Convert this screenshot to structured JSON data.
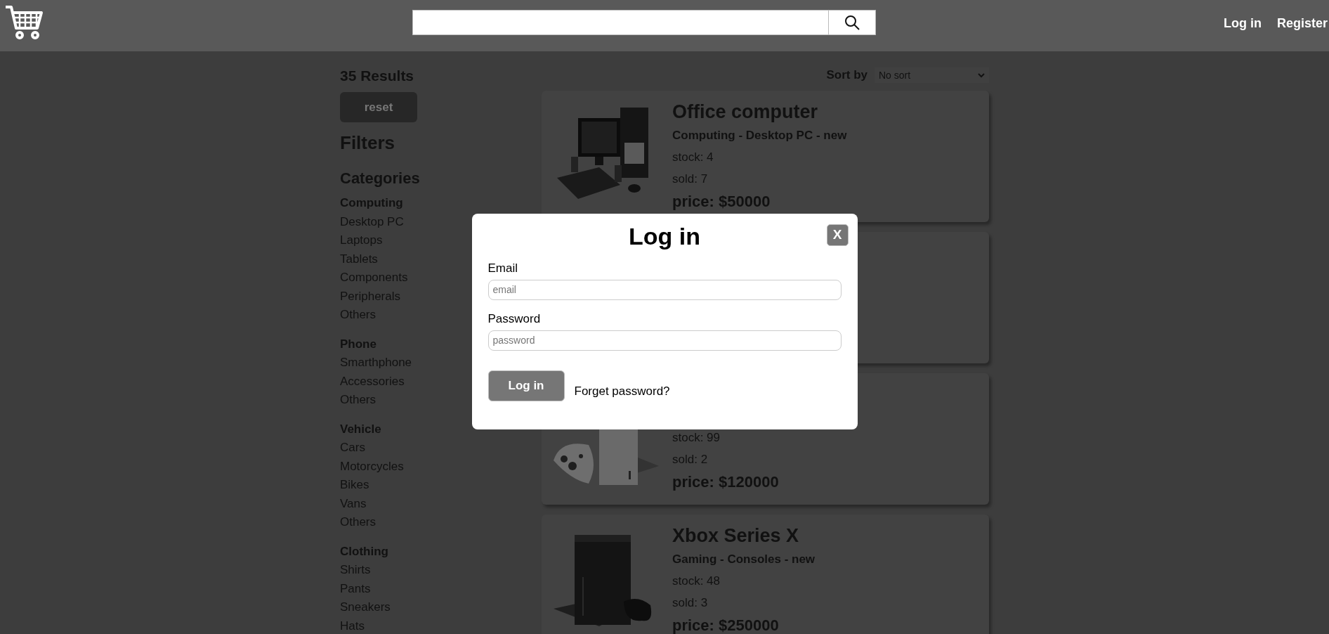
{
  "header": {
    "links": [
      "Log in",
      "Register"
    ]
  },
  "sidebar": {
    "results": "35 Results",
    "reset": "reset",
    "filters_title": "Filters",
    "categories_title": "Categories",
    "groups": [
      {
        "name": "Computing",
        "items": [
          "Desktop PC",
          "Laptops",
          "Tablets",
          "Components",
          "Peripherals",
          "Others"
        ]
      },
      {
        "name": "Phone",
        "items": [
          "Smarthphone",
          "Accessories",
          "Others"
        ]
      },
      {
        "name": "Vehicle",
        "items": [
          "Cars",
          "Motorcycles",
          "Bikes",
          "Vans",
          "Others"
        ]
      },
      {
        "name": "Clothing",
        "items": [
          "Shirts",
          "Pants",
          "Sneakers",
          "Hats"
        ]
      }
    ]
  },
  "sort": {
    "label": "Sort by",
    "value": "No sort"
  },
  "products": [
    {
      "kind": "product",
      "title": "Office computer",
      "subtitle": "Computing - Desktop PC - new",
      "stock": "stock: 4",
      "sold": "sold: 7",
      "price": "price: $50000"
    },
    {
      "kind": "covered"
    },
    {
      "kind": "product",
      "stock": "stock: 99",
      "sold": "sold: 2",
      "price": "price: $120000"
    },
    {
      "kind": "product",
      "title": "Xbox Series X",
      "subtitle": "Gaming - Consoles - new",
      "stock": "stock: 48",
      "sold": "sold: 3",
      "price": "price: $250000"
    }
  ],
  "modal": {
    "title": "Log in",
    "close": "X",
    "fields": [
      {
        "label": "Email",
        "placeholder": "email"
      },
      {
        "label": "Password",
        "placeholder": "password"
      }
    ],
    "submit": "Log in",
    "forgot": "Forget password?"
  }
}
